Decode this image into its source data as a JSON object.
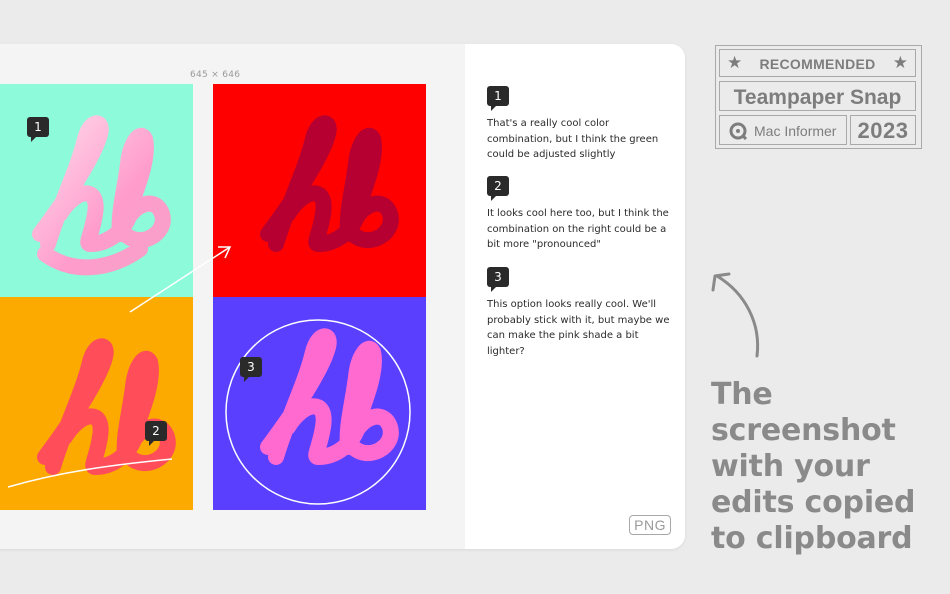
{
  "window": {
    "image_dimensions": "645 × 646",
    "format_tag": "PNG",
    "markers": [
      "1",
      "2",
      "3"
    ],
    "logo_text": "hb"
  },
  "comments": [
    {
      "number": "1",
      "text": "That's a really cool color combination, but I think the green could be adjusted slightly"
    },
    {
      "number": "2",
      "text": "It looks cool here too, but I think the combination on the right could be a bit more \"pronounced\""
    },
    {
      "number": "3",
      "text": "This option looks really cool. We'll probably stick with it, but maybe we can make the pink shade a bit lighter?"
    }
  ],
  "award": {
    "label": "RECOMMENDED",
    "product": "Teampaper Snap",
    "source": "Mac Informer",
    "year": "2023"
  },
  "tagline": {
    "lines": [
      "The",
      "screenshot",
      "with your",
      "edits copied",
      "to clipboard"
    ]
  },
  "colors": {
    "mint": "#8dfad9",
    "red": "#fe0000",
    "orange": "#fdaa00",
    "violet": "#5a3fff",
    "badge": "#2a2a2a"
  },
  "icons": [
    "star-icon",
    "mac-informer-logo-icon",
    "curved-arrow-icon",
    "annotation-arrow-icon"
  ]
}
